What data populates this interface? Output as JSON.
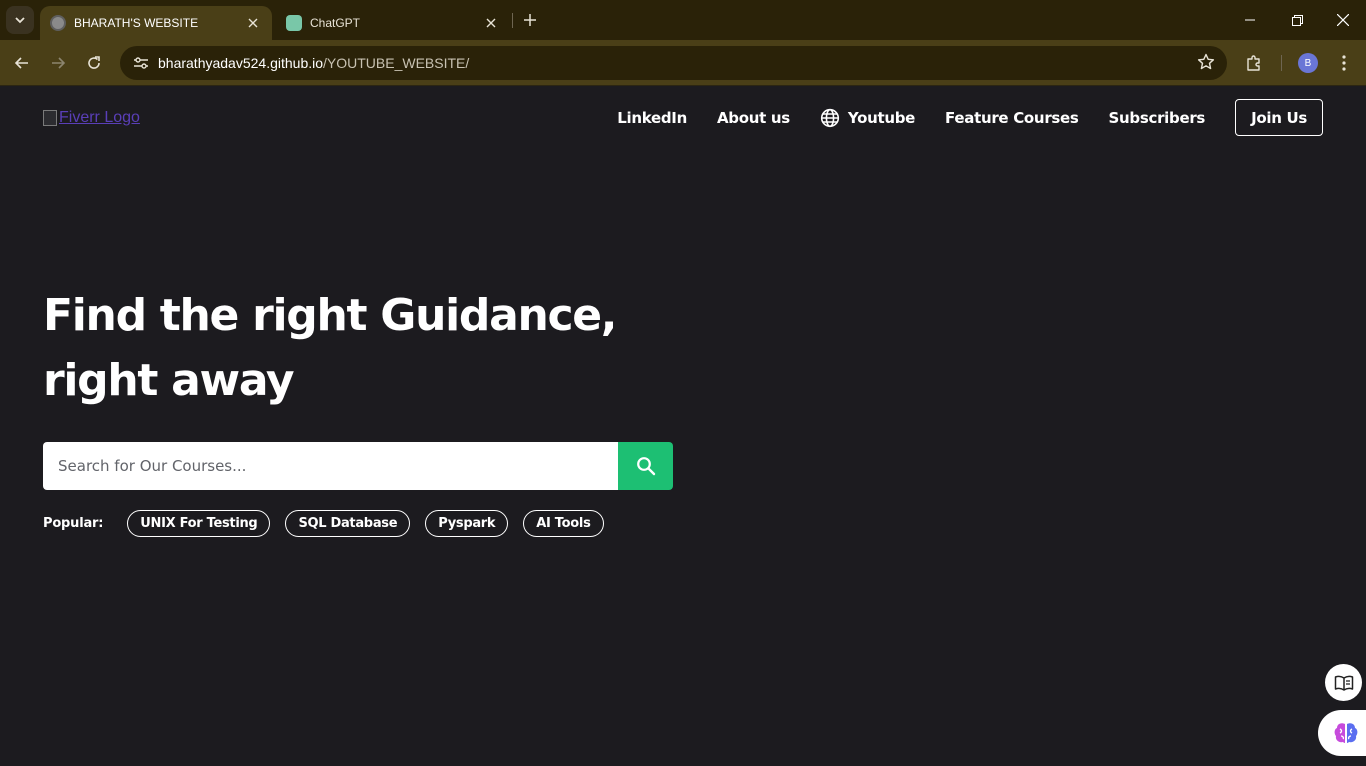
{
  "browser": {
    "tabs": [
      {
        "title": "BHARATH'S WEBSITE",
        "active": true
      },
      {
        "title": "ChatGPT",
        "active": false
      }
    ],
    "url_domain": "bharathyadav524.github.io",
    "url_path": "/YOUTUBE_WEBSITE/",
    "profile_initial": "B"
  },
  "header": {
    "logo_alt": "Fiverr Logo",
    "nav": {
      "linkedin": "LinkedIn",
      "about": "About us",
      "youtube": "Youtube",
      "courses": "Feature Courses",
      "subscribers": "Subscribers",
      "join": "Join Us"
    }
  },
  "hero": {
    "line1": "Find the right Guidance,",
    "line2": "right away"
  },
  "search": {
    "placeholder": "Search for Our Courses..."
  },
  "popular": {
    "label": "Popular:",
    "tags": [
      "UNIX For Testing",
      "SQL Database",
      "Pyspark",
      "AI Tools"
    ]
  },
  "colors": {
    "page_bg": "#1c1b1f",
    "accent_green": "#1dbf73",
    "browser_frame": "#4a3f17"
  }
}
